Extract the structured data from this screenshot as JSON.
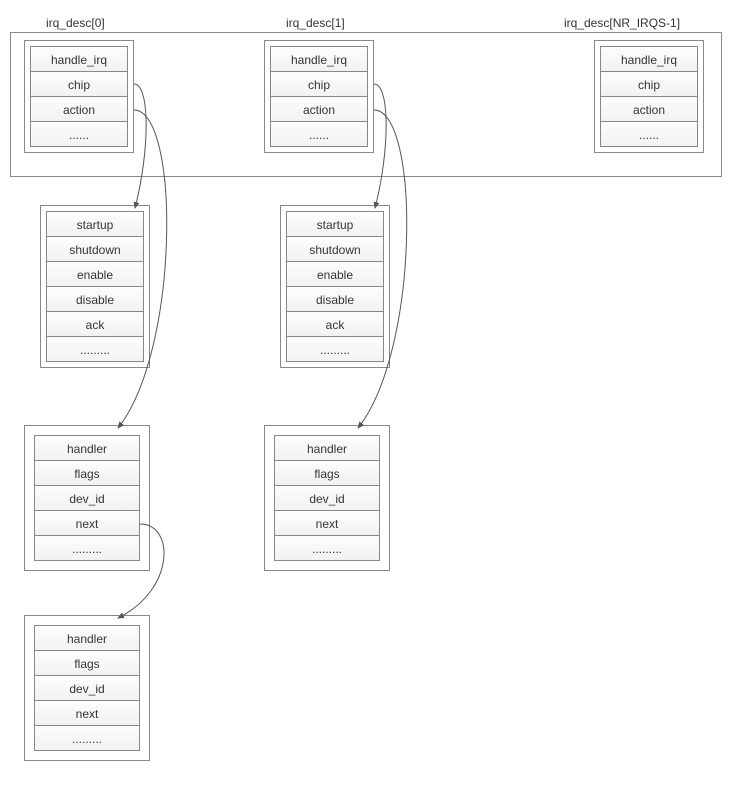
{
  "labels": {
    "irq0": "irq_desc[0]",
    "irq1": "irq_desc[1]",
    "irqN": "irq_desc[NR_IRQS-1]"
  },
  "desc_fields": {
    "f0": "handle_irq",
    "f1": "chip",
    "f2": "action",
    "f3": "......"
  },
  "chip_fields": {
    "f0": "startup",
    "f1": "shutdown",
    "f2": "enable",
    "f3": "disable",
    "f4": "ack",
    "f5": "........."
  },
  "action_fields": {
    "f0": "handler",
    "f1": "flags",
    "f2": "dev_id",
    "f3": "next",
    "f4": "........."
  }
}
